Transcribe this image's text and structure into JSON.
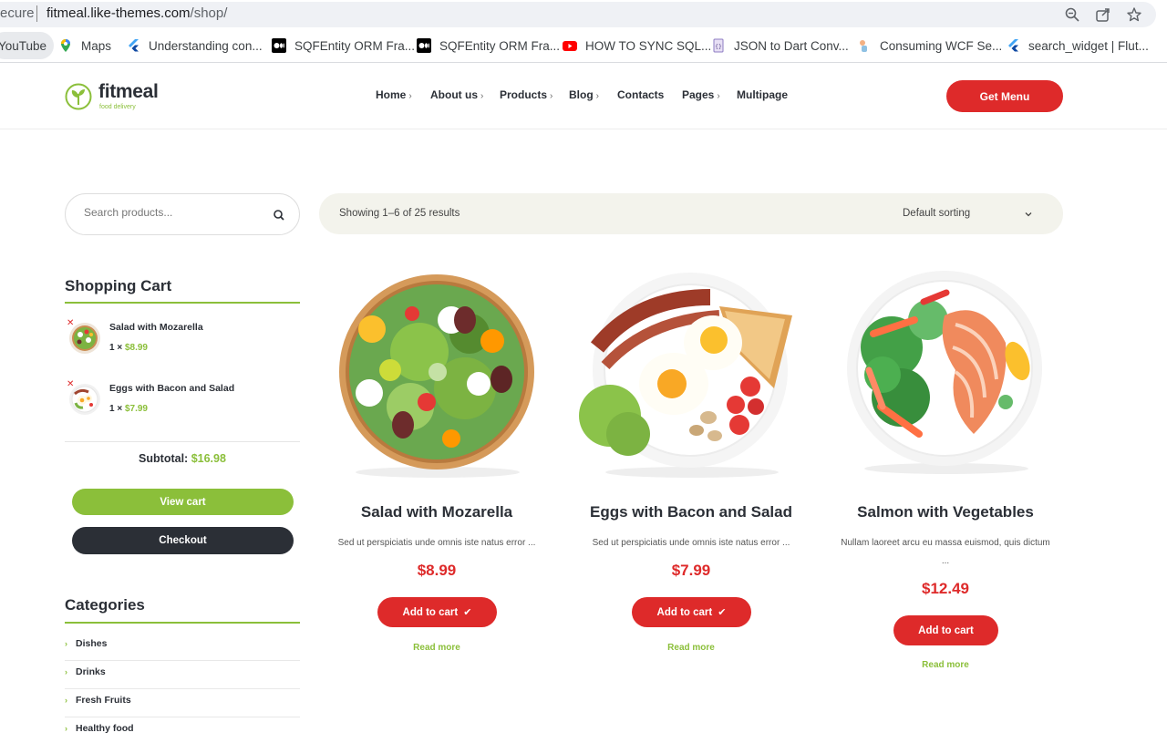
{
  "browser": {
    "secure_label": "ecure",
    "url_host": "fitmeal.like-themes.com",
    "url_path": "/shop/",
    "icons": [
      "zoom-icon",
      "share-icon",
      "star-icon"
    ],
    "bookmarks": [
      {
        "label": "YouTube",
        "icon": "youtube-icon"
      },
      {
        "label": "Maps",
        "icon": "maps-icon"
      },
      {
        "label": "Understanding con...",
        "icon": "flutter-icon"
      },
      {
        "label": "SQFEntity ORM Fra...",
        "icon": "medium-icon"
      },
      {
        "label": "SQFEntity ORM Fra...",
        "icon": "medium-icon"
      },
      {
        "label": "HOW TO SYNC SQL...",
        "icon": "youtube-icon"
      },
      {
        "label": "JSON to Dart Conv...",
        "icon": "json-icon"
      },
      {
        "label": "Consuming WCF Se...",
        "icon": "wcf-icon"
      },
      {
        "label": "search_widget | Flut...",
        "icon": "flutter-icon"
      }
    ]
  },
  "site": {
    "logo_name": "fitmeal",
    "logo_tagline": "food delivery",
    "nav": [
      {
        "label": "Home",
        "has_submenu": true
      },
      {
        "label": "About us",
        "has_submenu": true
      },
      {
        "label": "Products",
        "has_submenu": true
      },
      {
        "label": "Blog",
        "has_submenu": true
      },
      {
        "label": "Contacts",
        "has_submenu": false
      },
      {
        "label": "Pages",
        "has_submenu": true
      },
      {
        "label": "Multipage",
        "has_submenu": false
      }
    ],
    "cta_label": "Get Menu",
    "colors": {
      "accent": "#de2a2a",
      "green": "#8bbf3a",
      "dark": "#2b2f36"
    }
  },
  "sidebar": {
    "search_placeholder": "Search products...",
    "cart_title": "Shopping Cart",
    "cart_items": [
      {
        "name": "Salad with Mozarella",
        "qty": "1 ×",
        "price": "$8.99"
      },
      {
        "name": "Eggs with Bacon and Salad",
        "qty": "1 ×",
        "price": "$7.99"
      }
    ],
    "subtotal_label": "Subtotal:",
    "subtotal_value": "$16.98",
    "view_cart_label": "View cart",
    "checkout_label": "Checkout",
    "categories_title": "Categories",
    "categories": [
      "Dishes",
      "Drinks",
      "Fresh Fruits",
      "Healthy food"
    ]
  },
  "shop": {
    "result_count": "Showing 1–6 of 25 results",
    "sorting_label": "Default sorting",
    "add_to_cart_label": "Add to cart",
    "read_more_label": "Read more",
    "products": [
      {
        "title": "Salad with Mozarella",
        "desc": "Sed ut perspiciatis unde omnis iste natus error ...",
        "price": "$8.99",
        "in_cart": true
      },
      {
        "title": "Eggs with Bacon and Salad",
        "desc": "Sed ut perspiciatis unde omnis iste natus error ...",
        "price": "$7.99",
        "in_cart": true
      },
      {
        "title": "Salmon with Vegetables",
        "desc": "Nullam laoreet arcu eu massa euismod, quis dictum ...",
        "price": "$12.49",
        "in_cart": false
      }
    ]
  }
}
